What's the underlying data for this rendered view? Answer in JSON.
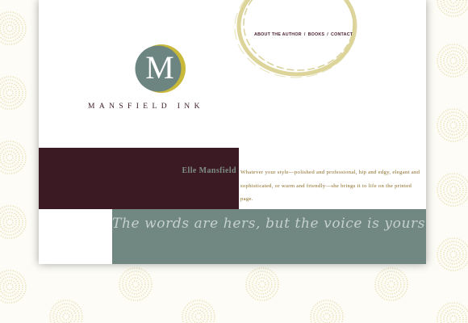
{
  "nav": {
    "about_label": "ABOUT THE AUTHOR",
    "books_label": "BOOKS",
    "contact_label": "CONTACT",
    "separator": "/"
  },
  "logo": {
    "letter": "M",
    "wordmark": "MANSFIELD INK"
  },
  "hero": {
    "author_name": "Elle Mansfield",
    "intro": "Whatever your style—polished and professional, hip and edgy, elegant and sophisticated, or warm and friendly—she brings it to life on the printed page."
  },
  "tagline": "The words are hers, but the voice is yours.",
  "colors": {
    "plum": "#3b1a24",
    "slate": "#708782",
    "gold": "#d6cd87",
    "logo_fill": "#6c8581",
    "dot_pattern": "#e9e1b6"
  },
  "icons": {
    "background": "dotted-circle-pattern",
    "decoration": "brush-ring-decoration",
    "logo": "logo-badge"
  }
}
